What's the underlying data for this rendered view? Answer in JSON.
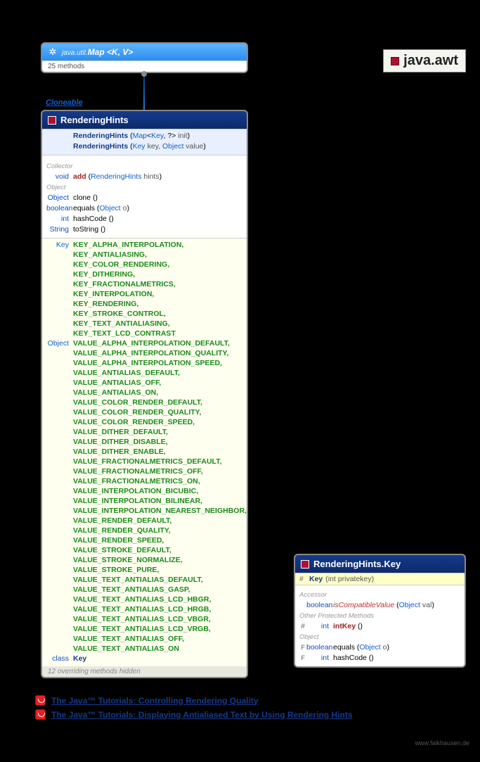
{
  "package_name": "java.awt",
  "map_box": {
    "pkg": "java.util.",
    "cls": "Map",
    "generics": "<K, V>",
    "sub": "25 methods"
  },
  "cloneable": "Cloneable",
  "rh": {
    "title": "RenderingHints",
    "ctor1_name": "RenderingHints",
    "ctor1_sig_a": "Map",
    "ctor1_sig_b": "Key",
    "ctor1_sig_c": "init",
    "ctor2_name": "RenderingHints",
    "ctor2_sig_a": "Key",
    "ctor2_sig_b": "key,",
    "ctor2_sig_c": "Object",
    "ctor2_sig_d": "value",
    "cat_collector": "Collector",
    "m_add_ret": "void",
    "m_add": "add",
    "m_add_p_t": "RenderingHints",
    "m_add_p_n": "hints",
    "cat_object": "Object",
    "m_clone_ret": "Object",
    "m_clone": "clone",
    "m_equals_ret": "boolean",
    "m_equals": "equals",
    "m_equals_p_t": "Object",
    "m_equals_p_n": "o",
    "m_hash_ret": "int",
    "m_hash": "hashCode",
    "m_tostr_ret": "String",
    "m_tostr": "toString",
    "keys_ret": "Key",
    "keys": [
      "KEY_ALPHA_INTERPOLATION,",
      "KEY_ANTIALIASING,",
      "KEY_COLOR_RENDERING,",
      "KEY_DITHERING,",
      "KEY_FRACTIONALMETRICS,",
      "KEY_INTERPOLATION,",
      "KEY_RENDERING,",
      "KEY_STROKE_CONTROL,",
      "KEY_TEXT_ANTIALIASING,",
      "KEY_TEXT_LCD_CONTRAST"
    ],
    "values_ret": "Object",
    "values": [
      "VALUE_ALPHA_INTERPOLATION_DEFAULT,",
      "VALUE_ALPHA_INTERPOLATION_QUALITY,",
      "VALUE_ALPHA_INTERPOLATION_SPEED,",
      "VALUE_ANTIALIAS_DEFAULT,",
      "VALUE_ANTIALIAS_OFF,",
      "VALUE_ANTIALIAS_ON,",
      "VALUE_COLOR_RENDER_DEFAULT,",
      "VALUE_COLOR_RENDER_QUALITY,",
      "VALUE_COLOR_RENDER_SPEED,",
      "VALUE_DITHER_DEFAULT,",
      "VALUE_DITHER_DISABLE,",
      "VALUE_DITHER_ENABLE,",
      "VALUE_FRACTIONALMETRICS_DEFAULT,",
      "VALUE_FRACTIONALMETRICS_OFF,",
      "VALUE_FRACTIONALMETRICS_ON,",
      "VALUE_INTERPOLATION_BICUBIC,",
      "VALUE_INTERPOLATION_BILINEAR,",
      "VALUE_INTERPOLATION_NEAREST_NEIGHBOR,",
      "VALUE_RENDER_DEFAULT,",
      "VALUE_RENDER_QUALITY,",
      "VALUE_RENDER_SPEED,",
      "VALUE_STROKE_DEFAULT,",
      "VALUE_STROKE_NORMALIZE,",
      "VALUE_STROKE_PURE,",
      "VALUE_TEXT_ANTIALIAS_DEFAULT,",
      "VALUE_TEXT_ANTIALIAS_GASP,",
      "VALUE_TEXT_ANTIALIAS_LCD_HBGR,",
      "VALUE_TEXT_ANTIALIAS_LCD_HRGB,",
      "VALUE_TEXT_ANTIALIAS_LCD_VBGR,",
      "VALUE_TEXT_ANTIALIAS_LCD_VRGB,",
      "VALUE_TEXT_ANTIALIAS_OFF,",
      "VALUE_TEXT_ANTIALIAS_ON"
    ],
    "inner_class_label": "class",
    "inner_class": "Key",
    "footer": "12 overriding methods hidden"
  },
  "rhkey": {
    "title": "RenderingHints.Key",
    "ctor_sym": "#",
    "ctor_name": "Key",
    "ctor_p": "(int privatekey)",
    "cat_accessor": "Accessor",
    "m_icv_ret": "boolean",
    "m_icv": "isCompatibleValue",
    "m_icv_p_t": "Object",
    "m_icv_p_n": "val",
    "cat_other": "Other Protected Methods",
    "m_intkey_ret": "int",
    "m_intkey": "intKey",
    "cat_object": "Object",
    "m_equals_ret": "boolean",
    "m_equals": "equals",
    "m_equals_p_t": "Object",
    "m_equals_p_n": "o",
    "m_hash_ret": "int",
    "m_hash": "hashCode"
  },
  "links": {
    "l1": "The Java™ Tutorials: Controlling Rendering Quality",
    "l2": "The Java™ Tutorials: Displaying Antialiased Text by Using Rendering Hints"
  },
  "watermark": "www.falkhausen.de"
}
